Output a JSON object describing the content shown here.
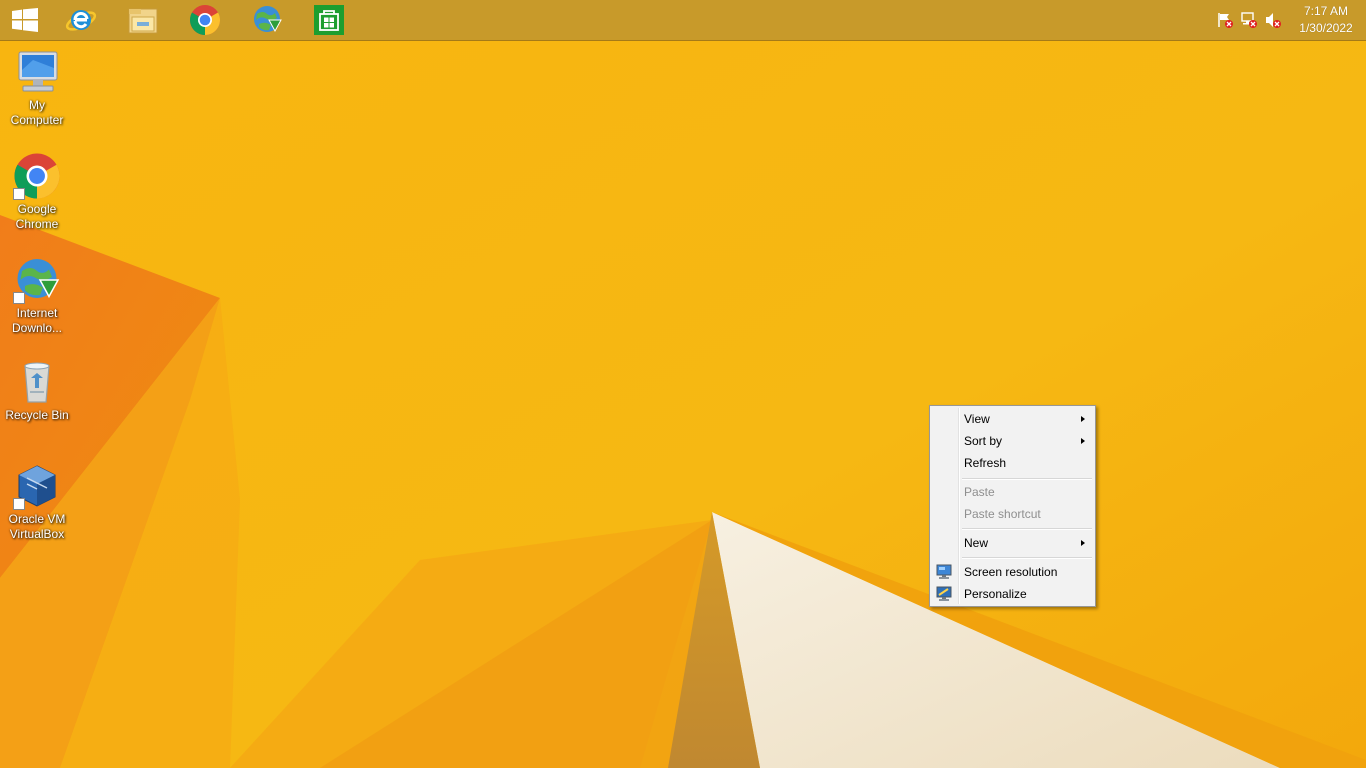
{
  "taskbar": {
    "pinned": [
      {
        "name": "start",
        "icon": "windows-logo-icon"
      },
      {
        "name": "internet-explorer",
        "icon": "internet-explorer-icon"
      },
      {
        "name": "file-explorer",
        "icon": "folder-icon"
      },
      {
        "name": "google-chrome",
        "icon": "chrome-icon"
      },
      {
        "name": "internet-download-manager",
        "icon": "idm-globe-icon"
      },
      {
        "name": "store",
        "icon": "store-bag-icon"
      }
    ],
    "tray_icons": [
      "action-center-flag-icon",
      "network-icon",
      "volume-muted-icon"
    ],
    "clock": {
      "time": "7:17 AM",
      "date": "1/30/2022"
    }
  },
  "desktop_icons": [
    {
      "label_line1": "My",
      "label_line2": "Computer",
      "icon": "computer-icon"
    },
    {
      "label_line1": "Google",
      "label_line2": "Chrome",
      "icon": "chrome-icon"
    },
    {
      "label_line1": "Internet",
      "label_line2": "Downlo...",
      "icon": "idm-globe-icon"
    },
    {
      "label_line1": "Recycle Bin",
      "label_line2": "",
      "icon": "recycle-bin-icon"
    },
    {
      "label_line1": "Oracle VM",
      "label_line2": "VirtualBox",
      "icon": "virtualbox-icon"
    }
  ],
  "context_menu": {
    "items": [
      {
        "label": "View",
        "submenu": true,
        "enabled": true
      },
      {
        "label": "Sort by",
        "submenu": true,
        "enabled": true
      },
      {
        "label": "Refresh",
        "submenu": false,
        "enabled": true
      },
      {
        "label": "Paste",
        "submenu": false,
        "enabled": false
      },
      {
        "label": "Paste shortcut",
        "submenu": false,
        "enabled": false
      },
      {
        "label": "New",
        "submenu": true,
        "enabled": true
      },
      {
        "label": "Screen resolution",
        "submenu": false,
        "enabled": true,
        "icon": "monitor-icon"
      },
      {
        "label": "Personalize",
        "submenu": false,
        "enabled": true,
        "icon": "personalize-monitor-icon"
      }
    ]
  },
  "colors": {
    "wallpaper_base": "#f7b20f",
    "wallpaper_orange": "#ef7d12",
    "wallpaper_cream": "#f4ead6",
    "taskbar": "#c89a2a",
    "menu_background": "#f2f2f2",
    "menu_disabled_text": "#8f8f8f"
  }
}
